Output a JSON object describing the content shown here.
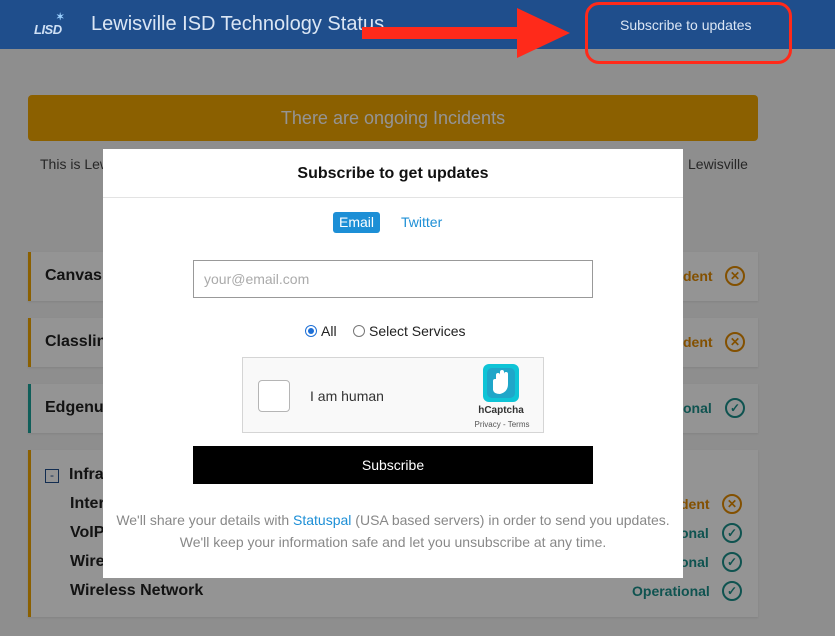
{
  "header": {
    "logo_text": "LISD",
    "title": "Lewisville ISD Technology Status",
    "subscribe_link": "Subscribe to updates"
  },
  "colors": {
    "header_bg": "#1f4e8c",
    "banner": "#f0a500",
    "incident": "#e28a00",
    "operational": "#1a8f8a",
    "annotation": "#ff2a1a",
    "modal_link": "#1d8fd6"
  },
  "page": {
    "banner": "There are ongoing Incidents",
    "description_left": "This is Lew",
    "description_right": "Lewisville",
    "services": [
      {
        "name": "Canvas",
        "status": "dent",
        "status_type": "incident",
        "icon": "x-circle-icon"
      },
      {
        "name": "Classlin",
        "status": "dent",
        "status_type": "incident",
        "icon": "x-circle-icon"
      },
      {
        "name": "Edgenui",
        "status": "onal",
        "status_type": "operational",
        "icon": "check-circle-icon"
      }
    ],
    "group": {
      "name": "Infra",
      "collapse_symbol": "-",
      "items": [
        {
          "name": "Inter",
          "status": "dent",
          "status_type": "incident",
          "icon": "x-circle-icon"
        },
        {
          "name": "VoIP",
          "status": "onal",
          "status_type": "operational",
          "icon": "check-circle-icon"
        },
        {
          "name": "Wire",
          "status": "onal",
          "status_type": "operational",
          "icon": "check-circle-icon"
        },
        {
          "name": "Wireless Network",
          "status": "Operational",
          "status_type": "operational",
          "icon": "check-circle-icon"
        }
      ]
    }
  },
  "modal": {
    "title": "Subscribe to get updates",
    "tabs": [
      {
        "label": "Email",
        "active": true
      },
      {
        "label": "Twitter",
        "active": false
      }
    ],
    "email_placeholder": "your@email.com",
    "email_value": "",
    "radio_options": [
      {
        "label": "All",
        "checked": true
      },
      {
        "label": "Select Services",
        "checked": false
      }
    ],
    "captcha": {
      "label": "I am human",
      "brand": "hCaptcha",
      "links": "Privacy - Terms"
    },
    "subscribe_button": "Subscribe",
    "footnote": {
      "line1_before": "We'll share your details with ",
      "line1_link": "Statuspal",
      "line1_after": " (USA based servers) in order to send you updates.",
      "line2": "We'll keep your information safe and let you unsubscribe at any time."
    }
  }
}
